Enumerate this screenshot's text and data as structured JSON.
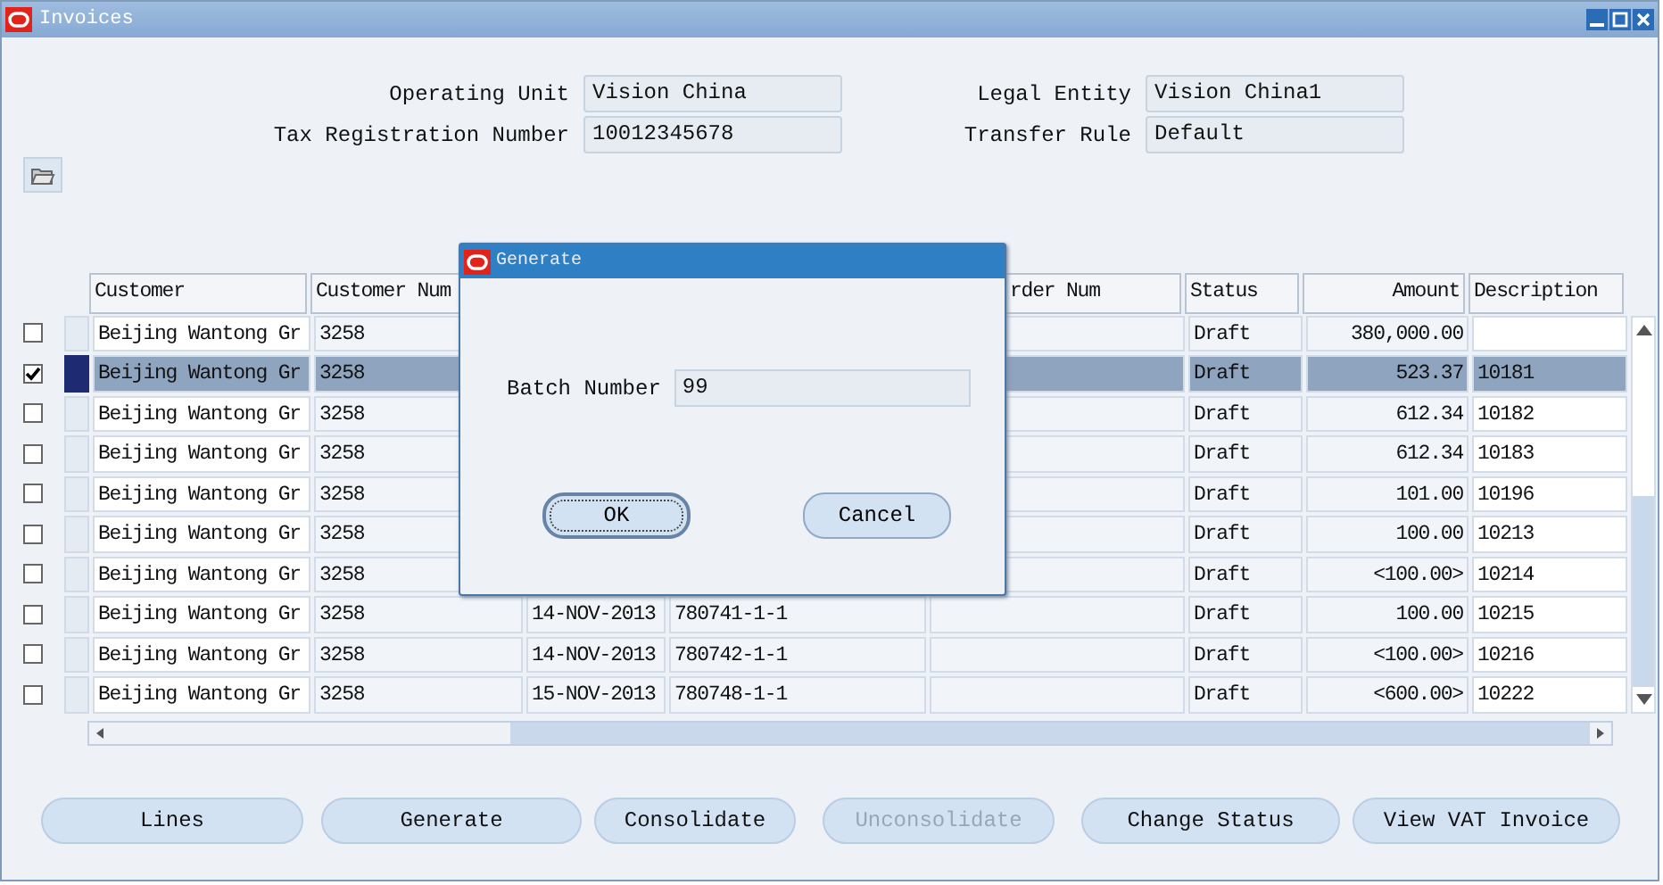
{
  "window": {
    "title": "Invoices"
  },
  "header_fields": [
    {
      "label": "Operating Unit",
      "value": "Vision China"
    },
    {
      "label": "Legal Entity",
      "value": "Vision China1"
    },
    {
      "label": "Tax Registration Number",
      "value": "10012345678"
    },
    {
      "label": "Transfer Rule",
      "value": "Default"
    }
  ],
  "table": {
    "columns": [
      "Customer",
      "Customer Num",
      "",
      "",
      "rder Num",
      "Status",
      "Amount",
      "Description"
    ],
    "rows": [
      {
        "checked": false,
        "selected": false,
        "customer": "Beijing Wantong Gr",
        "customer_num": "3258",
        "status": "Draft",
        "amount": "380,000.00",
        "description": ""
      },
      {
        "checked": true,
        "selected": true,
        "customer": "Beijing Wantong Gr",
        "customer_num": "3258",
        "status": "Draft",
        "amount": "523.37",
        "description": "10181"
      },
      {
        "checked": false,
        "selected": false,
        "customer": "Beijing Wantong Gr",
        "customer_num": "3258",
        "status": "Draft",
        "amount": "612.34",
        "description": "10182"
      },
      {
        "checked": false,
        "selected": false,
        "customer": "Beijing Wantong Gr",
        "customer_num": "3258",
        "status": "Draft",
        "amount": "612.34",
        "description": "10183"
      },
      {
        "checked": false,
        "selected": false,
        "customer": "Beijing Wantong Gr",
        "customer_num": "3258",
        "status": "Draft",
        "amount": "101.00",
        "description": "10196"
      },
      {
        "checked": false,
        "selected": false,
        "customer": "Beijing Wantong Gr",
        "customer_num": "3258",
        "status": "Draft",
        "amount": "100.00",
        "description": "10213"
      },
      {
        "checked": false,
        "selected": false,
        "customer": "Beijing Wantong Gr",
        "customer_num": "3258",
        "status": "Draft",
        "amount": "<100.00>",
        "description": "10214"
      },
      {
        "checked": false,
        "selected": false,
        "customer": "Beijing Wantong Gr",
        "customer_num": "3258",
        "date": "14-NOV-2013",
        "trx_num": "780741-1-1",
        "status": "Draft",
        "amount": "100.00",
        "description": "10215"
      },
      {
        "checked": false,
        "selected": false,
        "customer": "Beijing Wantong Gr",
        "customer_num": "3258",
        "date": "14-NOV-2013",
        "trx_num": "780742-1-1",
        "status": "Draft",
        "amount": "<100.00>",
        "description": "10216"
      },
      {
        "checked": false,
        "selected": false,
        "customer": "Beijing Wantong Gr",
        "customer_num": "3258",
        "date": "15-NOV-2013",
        "trx_num": "780748-1-1",
        "status": "Draft",
        "amount": "<600.00>",
        "description": "10222"
      }
    ]
  },
  "buttons": [
    {
      "label": "Lines",
      "disabled": false
    },
    {
      "label": "Generate",
      "disabled": false
    },
    {
      "label": "Consolidate",
      "disabled": false
    },
    {
      "label": "Unconsolidate",
      "disabled": true
    },
    {
      "label": "Change Status",
      "disabled": false
    },
    {
      "label": "View VAT Invoice",
      "disabled": false
    }
  ],
  "dialog": {
    "title": "Generate",
    "field_label": "Batch Number",
    "field_value": "99",
    "buttons": [
      "OK",
      "Cancel"
    ]
  }
}
